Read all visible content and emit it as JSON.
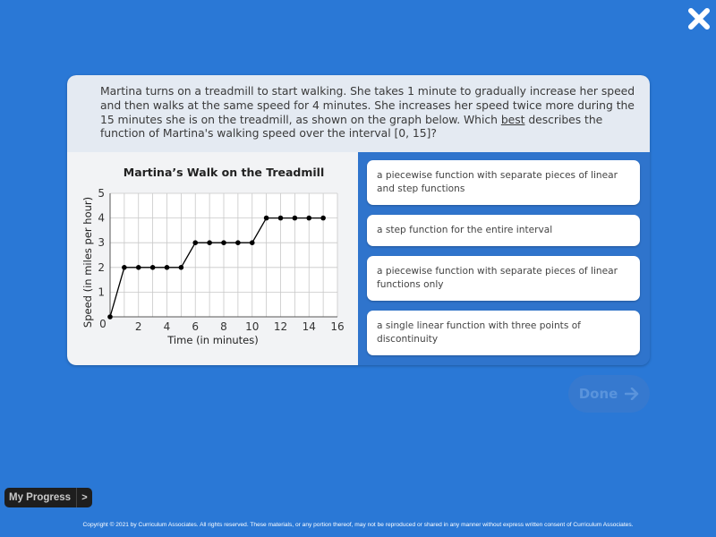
{
  "close_button": {
    "icon": "close-icon"
  },
  "question": {
    "text_before": "Martina turns on a treadmill to start walking. She takes 1 minute to gradually increase her speed and then walks at the same speed for 4 minutes. She increases her speed twice more during the 15 minutes she is on the treadmill, as shown on the graph below. Which ",
    "emphasis": "best",
    "text_after": " describes the function of Martina's walking speed over the interval [0, 15]?"
  },
  "chart_data": {
    "type": "line",
    "title": "Martina’s Walk on the Treadmill",
    "xlabel": "Time (in minutes)",
    "ylabel": "Speed (in miles per hour)",
    "xlim": [
      0,
      16
    ],
    "ylim": [
      0,
      5
    ],
    "x_ticks": [
      2,
      4,
      6,
      8,
      10,
      12,
      14,
      16
    ],
    "y_ticks": [
      1,
      2,
      3,
      4,
      5
    ],
    "origin_label": "0",
    "grid": true,
    "x": [
      0,
      1,
      2,
      3,
      4,
      5,
      6,
      7,
      8,
      9,
      10,
      11,
      12,
      13,
      14,
      15
    ],
    "y": [
      0,
      2,
      2,
      2,
      2,
      2,
      3,
      3,
      3,
      3,
      3,
      4,
      4,
      4,
      4,
      4
    ],
    "markers": true,
    "line_color": "#000000",
    "grid_color": "#c8c8c8",
    "plot_bg": "#ffffff"
  },
  "choices": [
    {
      "label": "a piecewise function with separate pieces of linear and step functions"
    },
    {
      "label": "a step function for the entire interval"
    },
    {
      "label": "a piecewise function with separate pieces of linear functions only"
    },
    {
      "label": "a single linear function with three points of discontinuity"
    }
  ],
  "done_button": {
    "label": "Done",
    "icon": "arrow-right-icon",
    "enabled": false
  },
  "progress_button": {
    "label": "My Progress",
    "arrow": ">"
  },
  "footer": {
    "copyright": "Copyright © 2021 by Curriculum Associates. All rights reserved. These materials, or any portion thereof, may not be reproduced or shared in any manner without express written consent of Curriculum Associates."
  },
  "colors": {
    "background": "#2a78d6",
    "prompt_bg": "#e4eaf2",
    "chart_bg": "#f2f3f5"
  }
}
